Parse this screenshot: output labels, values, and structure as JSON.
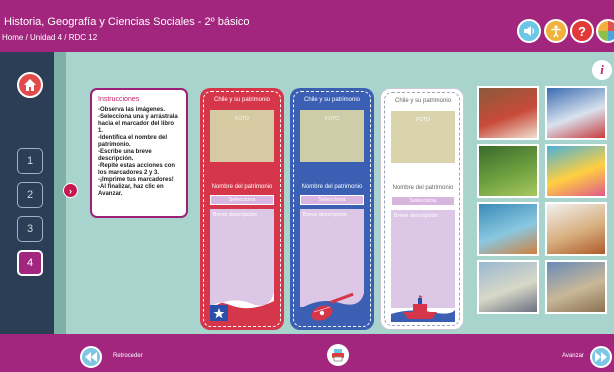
{
  "header": {
    "title": "Historia, Geografía y Ciencias Sociales - 2º básico",
    "breadcrumb": "Home / Unidad 4 / RDC 12"
  },
  "sidebar": {
    "items": [
      {
        "label": "1",
        "active": false
      },
      {
        "label": "2",
        "active": false
      },
      {
        "label": "3",
        "active": false
      },
      {
        "label": "4",
        "active": true
      }
    ]
  },
  "instructions": {
    "title": "Instrucciones",
    "body": "-Observa las imágenes.\n-Selecciona una y arrástrala hacia el marcador del libro 1.\n-Identifica el nombre del patrimonio.\n-Escribe una breve descripción.\n-Repite estas acciones con los marcadores 2 y 3.\n-¡Imprime tus marcadores!\n-Al finalizar, haz clic en Avanzar."
  },
  "cards": [
    {
      "header": "Chile y su patrimonio",
      "photo_hint": "FOTO",
      "name_label": "Nombre del patrimonio",
      "select": "Selecciona",
      "desc": "Breve descripción",
      "color": "#d6364a",
      "marker": "flag"
    },
    {
      "header": "Chile y su patrimonio",
      "photo_hint": "FOTO",
      "name_label": "Nombre del patrimonio",
      "select": "Selecciona",
      "desc": "Breve descripción",
      "color": "#3a5fb3",
      "marker": "guitar"
    },
    {
      "header": "Chile y su patrimonio",
      "photo_hint": "FOTO",
      "name_label": "Nombre del patrimonio",
      "select": "Selecciona",
      "desc": "Breve descripción",
      "color": "#ffffff",
      "marker": "ship"
    }
  ],
  "thumbnails": [
    {
      "name": "dancers-photo",
      "colors": [
        "#8a5a3a",
        "#c84a3a",
        "#f0e0d0"
      ]
    },
    {
      "name": "cueca-dancers-photo",
      "colors": [
        "#3a6ab0",
        "#d8e2ee",
        "#c83a3a"
      ]
    },
    {
      "name": "leaves-photo",
      "colors": [
        "#3a6a2a",
        "#6ea040",
        "#a8c860"
      ]
    },
    {
      "name": "mermaid-photo",
      "colors": [
        "#4ab0d8",
        "#ffd040",
        "#e05a8a"
      ]
    },
    {
      "name": "canoe-photo",
      "colors": [
        "#3a8ab8",
        "#8ac8e0",
        "#d08040"
      ]
    },
    {
      "name": "spinning-top-photo",
      "colors": [
        "#f0f0f0",
        "#d8b080",
        "#b05a2a"
      ]
    },
    {
      "name": "bay-photo",
      "colors": [
        "#9ab8d0",
        "#d8d8c8",
        "#6a7080"
      ]
    },
    {
      "name": "building-photo",
      "colors": [
        "#6a8ab8",
        "#c8b898",
        "#8a7050"
      ]
    }
  ],
  "footer": {
    "back_label": "Retroceder",
    "next_label": "Avanzar"
  },
  "colors": {
    "brand": "#a3267e",
    "main_bg": "#a8d4cd",
    "sidebar": "#2b3e55"
  }
}
